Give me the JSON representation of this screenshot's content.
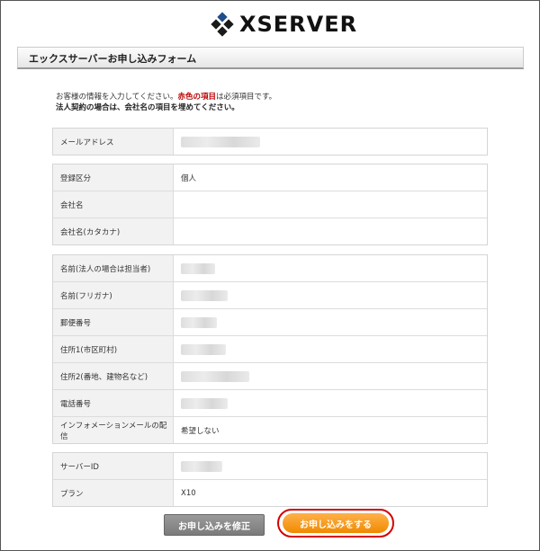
{
  "logo": {
    "text": "XSERVER"
  },
  "form_title": "エックスサーバーお申し込みフォーム",
  "intro": {
    "line1_before": "お客様の情報を入力してください。",
    "line1_required": "赤色の項目",
    "line1_after": "は必須項目です。",
    "line2": "法人契約の場合は、会社名の項目を埋めてください。"
  },
  "groups": [
    {
      "rows": [
        {
          "label": "メールアドレス",
          "value": ""
        }
      ]
    },
    {
      "rows": [
        {
          "label": "登録区分",
          "value": "個人"
        },
        {
          "label": "会社名",
          "value": ""
        },
        {
          "label": "会社名(カタカナ)",
          "value": ""
        }
      ]
    },
    {
      "rows": [
        {
          "label": "名前(法人の場合は担当者)",
          "value": ""
        },
        {
          "label": "名前(フリガナ)",
          "value": ""
        },
        {
          "label": "郵便番号",
          "value": ""
        },
        {
          "label": "住所1(市区町村)",
          "value": ""
        },
        {
          "label": "住所2(番地、建物名など)",
          "value": ""
        },
        {
          "label": "電話番号",
          "value": ""
        },
        {
          "label": "インフォメーションメールの配信",
          "value": "希望しない"
        }
      ]
    },
    {
      "rows": [
        {
          "label": "サーバーID",
          "value": ""
        },
        {
          "label": "プラン",
          "value": "X10"
        }
      ]
    }
  ],
  "buttons": {
    "edit": "お申し込みを修正",
    "submit": "お申し込みをする"
  },
  "colors": {
    "required": "#b00000",
    "submit": "#f08a00",
    "highlight_ring": "#d40000"
  }
}
